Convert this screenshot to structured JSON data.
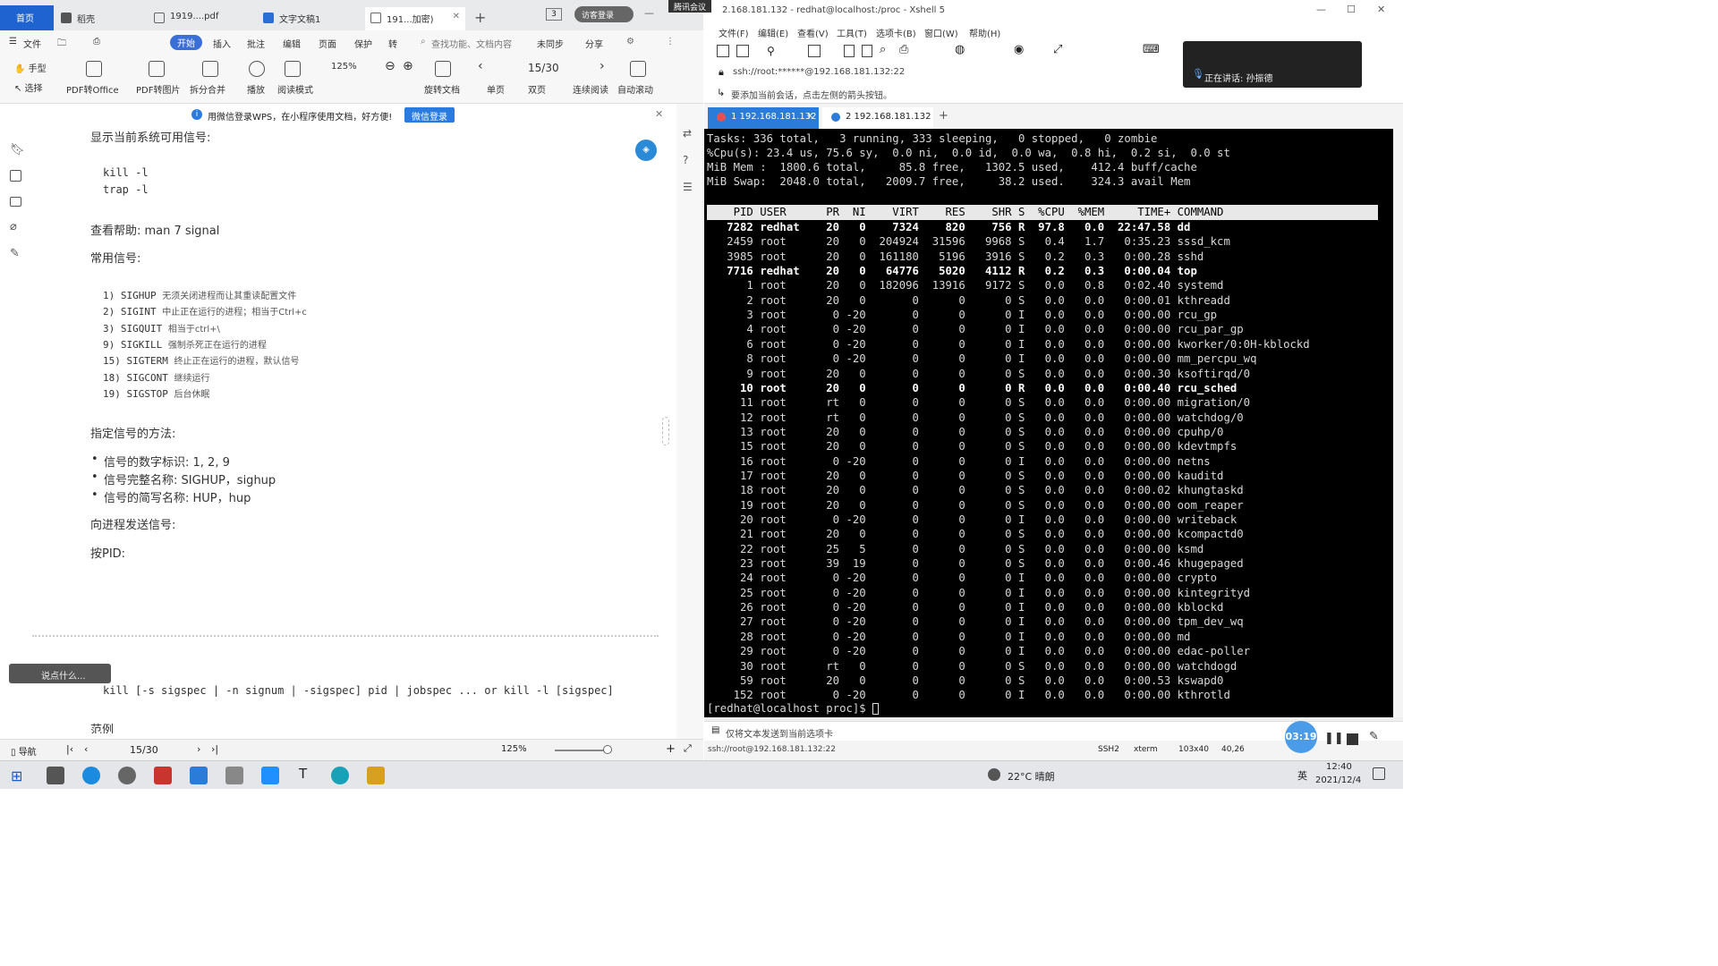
{
  "wps": {
    "tabs": [
      {
        "label": "首页"
      },
      {
        "label": "稻壳"
      },
      {
        "label": "1919....pdf"
      },
      {
        "label": "文字文稿1"
      },
      {
        "label": "191...加密)"
      }
    ],
    "page_badge": "3",
    "login_button": "访客登录",
    "menu": [
      "文件",
      "开始",
      "插入",
      "批注",
      "编辑",
      "页面",
      "保护",
      "转"
    ],
    "search_placeholder": "查找功能、文档内容",
    "sync": "未同步",
    "share": "分享",
    "toolbar": {
      "hand": "手型",
      "select": "选择",
      "pdf_office": "PDF转Office",
      "pdf_image": "PDF转图片",
      "split_merge": "拆分合并",
      "play": "播放",
      "read_mode": "阅读模式",
      "zoom": "125%",
      "rotate": "旋转文档",
      "page_indicator": "15/30",
      "single": "单页",
      "double": "双页",
      "continuous": "连续阅读",
      "auto_scroll": "自动滚动"
    },
    "notice": {
      "text": "用微信登录WPS，在小程序使用文档，好方便!",
      "button": "微信登录"
    },
    "doc": {
      "h_signals": "显示当前系统可用信号:",
      "code1": "kill -l",
      "code2": "trap -l",
      "help": "查看帮助: man 7 signal",
      "common": "常用信号:",
      "signals": [
        {
          "num": "1)",
          "name": "SIGHUP",
          "desc": "无须关闭进程而让其重读配置文件"
        },
        {
          "num": "2)",
          "name": "SIGINT",
          "desc": "中止正在运行的进程；相当于Ctrl+c"
        },
        {
          "num": "3)",
          "name": "SIGQUIT",
          "desc": "相当于ctrl+\\"
        },
        {
          "num": "9)",
          "name": "SIGKILL",
          "desc": "强制杀死正在运行的进程"
        },
        {
          "num": "15)",
          "name": "SIGTERM",
          "desc": "终止正在运行的进程，默认信号"
        },
        {
          "num": "18)",
          "name": "SIGCONT",
          "desc": "继续运行"
        },
        {
          "num": "19)",
          "name": "SIGSTOP",
          "desc": "后台休眠"
        }
      ],
      "specify": "指定信号的方法:",
      "bullets": [
        "信号的数字标识: 1, 2, 9",
        "信号完整名称: SIGHUP，sighup",
        "信号的简写名称: HUP，hup"
      ],
      "send": "向进程发送信号:",
      "by_pid": "按PID:",
      "kill_syntax": "kill [-s sigspec | -n signum | -sigspec] pid | jobspec ... or kill -l [sigspec]",
      "example": "范例"
    },
    "chat_bubble": "说点什么...",
    "status": {
      "nav": "导航",
      "page": "15/30",
      "zoom": "125%"
    }
  },
  "xshell": {
    "meeting_tag": "腾讯会议",
    "title": "2.168.181.132 - redhat@localhost:/proc - Xshell 5",
    "menu": [
      "文件(F)",
      "编辑(E)",
      "查看(V)",
      "工具(T)",
      "选项卡(B)",
      "窗口(W)",
      "帮助(H)"
    ],
    "address": "ssh://root:******@192.168.181.132:22",
    "hint": "要添加当前会话，点击左侧的箭头按钮。",
    "speaking": "正在讲话: 孙振德",
    "tabs": [
      {
        "label": "1 192.168.181.132"
      },
      {
        "label": "2 192.168.181.132"
      }
    ],
    "terminal": {
      "summary": [
        "Tasks: 336 total,   3 running, 333 sleeping,   0 stopped,   0 zombie",
        "%Cpu(s): 23.4 us, 75.6 sy,  0.0 ni,  0.0 id,  0.0 wa,  0.8 hi,  0.2 si,  0.0 st",
        "MiB Mem :  1800.6 total,     85.8 free,   1302.5 used,    412.4 buff/cache",
        "MiB Swap:  2048.0 total,   2009.7 free,     38.2 used.    324.3 avail Mem"
      ],
      "header": "    PID USER      PR  NI    VIRT    RES    SHR S  %CPU  %MEM     TIME+ COMMAND",
      "rows": [
        {
          "t": "   7282 redhat    20   0    7324    820    756 R  97.8   0.0  22:47.58 dd",
          "b": true
        },
        {
          "t": "   2459 root      20   0  204924  31596   9968 S   0.4   1.7   0:35.23 sssd_kcm",
          "b": false
        },
        {
          "t": "   3985 root      20   0  161180   5196   3916 S   0.2   0.3   0:00.28 sshd",
          "b": false
        },
        {
          "t": "   7716 redhat    20   0   64776   5020   4112 R   0.2   0.3   0:00.04 top",
          "b": true
        },
        {
          "t": "      1 root      20   0  182096  13916   9172 S   0.0   0.8   0:02.40 systemd",
          "b": false
        },
        {
          "t": "      2 root      20   0       0      0      0 S   0.0   0.0   0:00.01 kthreadd",
          "b": false
        },
        {
          "t": "      3 root       0 -20       0      0      0 I   0.0   0.0   0:00.00 rcu_gp",
          "b": false
        },
        {
          "t": "      4 root       0 -20       0      0      0 I   0.0   0.0   0:00.00 rcu_par_gp",
          "b": false
        },
        {
          "t": "      6 root       0 -20       0      0      0 I   0.0   0.0   0:00.00 kworker/0:0H-kblockd",
          "b": false
        },
        {
          "t": "      8 root       0 -20       0      0      0 I   0.0   0.0   0:00.00 mm_percpu_wq",
          "b": false
        },
        {
          "t": "      9 root      20   0       0      0      0 S   0.0   0.0   0:00.30 ksoftirqd/0",
          "b": false
        },
        {
          "t": "     10 root      20   0       0      0      0 R   0.0   0.0   0:00.40 rcu_sched",
          "b": true
        },
        {
          "t": "     11 root      rt   0       0      0      0 S   0.0   0.0   0:00.00 migration/0",
          "b": false
        },
        {
          "t": "     12 root      rt   0       0      0      0 S   0.0   0.0   0:00.00 watchdog/0",
          "b": false
        },
        {
          "t": "     13 root      20   0       0      0      0 S   0.0   0.0   0:00.00 cpuhp/0",
          "b": false
        },
        {
          "t": "     15 root      20   0       0      0      0 S   0.0   0.0   0:00.00 kdevtmpfs",
          "b": false
        },
        {
          "t": "     16 root       0 -20       0      0      0 I   0.0   0.0   0:00.00 netns",
          "b": false
        },
        {
          "t": "     17 root      20   0       0      0      0 S   0.0   0.0   0:00.00 kauditd",
          "b": false
        },
        {
          "t": "     18 root      20   0       0      0      0 S   0.0   0.0   0:00.02 khungtaskd",
          "b": false
        },
        {
          "t": "     19 root      20   0       0      0      0 S   0.0   0.0   0:00.00 oom_reaper",
          "b": false
        },
        {
          "t": "     20 root       0 -20       0      0      0 I   0.0   0.0   0:00.00 writeback",
          "b": false
        },
        {
          "t": "     21 root      20   0       0      0      0 S   0.0   0.0   0:00.00 kcompactd0",
          "b": false
        },
        {
          "t": "     22 root      25   5       0      0      0 S   0.0   0.0   0:00.00 ksmd",
          "b": false
        },
        {
          "t": "     23 root      39  19       0      0      0 S   0.0   0.0   0:00.46 khugepaged",
          "b": false
        },
        {
          "t": "     24 root       0 -20       0      0      0 I   0.0   0.0   0:00.00 crypto",
          "b": false
        },
        {
          "t": "     25 root       0 -20       0      0      0 I   0.0   0.0   0:00.00 kintegrityd",
          "b": false
        },
        {
          "t": "     26 root       0 -20       0      0      0 I   0.0   0.0   0:00.00 kblockd",
          "b": false
        },
        {
          "t": "     27 root       0 -20       0      0      0 I   0.0   0.0   0:00.00 tpm_dev_wq",
          "b": false
        },
        {
          "t": "     28 root       0 -20       0      0      0 I   0.0   0.0   0:00.00 md",
          "b": false
        },
        {
          "t": "     29 root       0 -20       0      0      0 I   0.0   0.0   0:00.00 edac-poller",
          "b": false
        },
        {
          "t": "     30 root      rt   0       0      0      0 S   0.0   0.0   0:00.00 watchdogd",
          "b": false
        },
        {
          "t": "     59 root      20   0       0      0      0 S   0.0   0.0   0:00.53 kswapd0",
          "b": false
        },
        {
          "t": "    152 root       0 -20       0      0      0 I   0.0   0.0   0:00.00 kthrotld",
          "b": false
        }
      ],
      "prompt": "[redhat@localhost proc]$ "
    },
    "send_hint": "仅将文本发送到当前选项卡",
    "status": {
      "conn": "ssh://root@192.168.181.132:22",
      "proto": "SSH2",
      "term": "xterm",
      "size": "103x40",
      "pos": "40,26"
    },
    "timer": "03:19"
  },
  "taskbar": {
    "weather": "22°C 晴朗",
    "ime": "英",
    "time": "12:40",
    "date": "2021/12/4"
  },
  "colors": {
    "wps_accent": "#1e63d0",
    "xshell_tab": "#2b7bd8",
    "terminal_bg": "#000000"
  }
}
